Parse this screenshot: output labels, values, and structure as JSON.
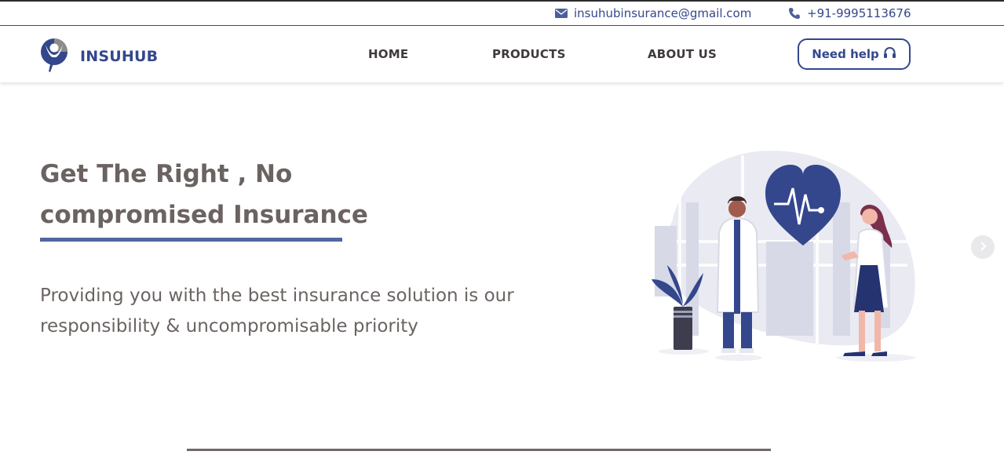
{
  "topbar": {
    "email": "insuhubinsurance@gmail.com",
    "phone": "+91-9995113676",
    "email_icon": "envelope-icon",
    "phone_icon": "phone-icon"
  },
  "brand": {
    "name": "INSUHUB",
    "logo_icon": "insuhub-logo-icon"
  },
  "nav": {
    "items": [
      {
        "label": "HOME"
      },
      {
        "label": "PRODUCTS"
      },
      {
        "label": "ABOUT US"
      }
    ],
    "help_label": "Need help",
    "help_icon": "headphones-icon"
  },
  "hero": {
    "title_line1": "Get The Right , No",
    "title_line2": "compromised Insurance",
    "subtitle_line1": "Providing you with the best insurance solution is our",
    "subtitle_line2": "responsibility & uncompromisable priority",
    "illustration": "doctors-heart-illustration",
    "carousel_icon": "chevron-right-icon"
  },
  "colors": {
    "brand": "#34478d",
    "accent": "#52679f",
    "text": "#6b6361"
  }
}
